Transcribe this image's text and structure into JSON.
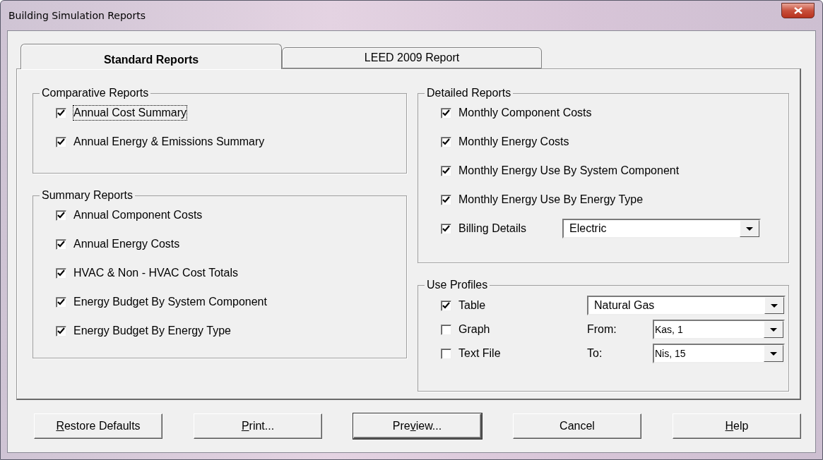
{
  "window": {
    "title": "Building Simulation Reports"
  },
  "tabs": [
    {
      "label": "Standard Reports",
      "selected": true
    },
    {
      "label": "LEED 2009 Report",
      "selected": false
    }
  ],
  "comparative_reports": {
    "title": "Comparative Reports",
    "items": [
      {
        "label": "Annual Cost Summary",
        "checked": true,
        "focused": true
      },
      {
        "label": "Annual Energy & Emissions Summary",
        "checked": true,
        "focused": false
      }
    ]
  },
  "summary_reports": {
    "title": "Summary Reports",
    "items": [
      {
        "label": "Annual Component Costs",
        "checked": true,
        "focused": false
      },
      {
        "label": "Annual Energy Costs",
        "checked": true,
        "focused": false
      },
      {
        "label": "HVAC & Non - HVAC Cost Totals",
        "checked": true,
        "focused": false
      },
      {
        "label": "Energy Budget By System Component",
        "checked": true,
        "focused": false
      },
      {
        "label": "Energy Budget By Energy Type",
        "checked": true,
        "focused": false
      }
    ]
  },
  "detailed_reports": {
    "title": "Detailed Reports",
    "items": [
      {
        "label": "Monthly Component Costs",
        "checked": true,
        "focused": false
      },
      {
        "label": "Monthly Energy Costs",
        "checked": true,
        "focused": false
      },
      {
        "label": "Monthly Energy Use By System Component",
        "checked": true,
        "focused": false
      },
      {
        "label": "Monthly Energy Use By Energy Type",
        "checked": true,
        "focused": false
      }
    ],
    "billing": {
      "label": "Billing Details",
      "checked": true,
      "value": "Electric"
    }
  },
  "use_profiles": {
    "title": "Use Profiles",
    "fuel": "Natural Gas",
    "options": [
      {
        "label": "Table",
        "checked": true
      },
      {
        "label": "Graph",
        "checked": false
      },
      {
        "label": "Text File",
        "checked": false
      }
    ],
    "from": {
      "label": "From:",
      "value": "Kas, 1"
    },
    "to": {
      "label": "To:",
      "value": "Nis, 15"
    }
  },
  "buttons": [
    {
      "key": "R",
      "after": "estore Defaults",
      "default": false
    },
    {
      "key": "P",
      "after": "rint...",
      "default": false
    },
    {
      "before": "Pre",
      "key": "v",
      "after": "iew...",
      "default": true
    },
    {
      "before": "Cancel",
      "default": false
    },
    {
      "key": "H",
      "after": "elp",
      "default": false
    }
  ]
}
